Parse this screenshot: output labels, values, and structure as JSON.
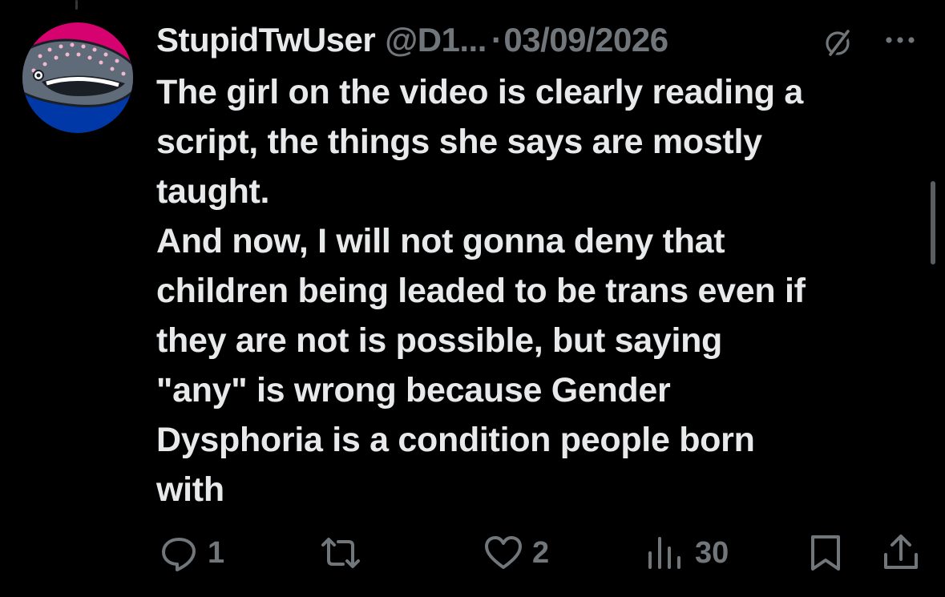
{
  "colors": {
    "background": "#000000",
    "primary_text": "#e7e9ea",
    "secondary_text": "#71767b",
    "avatar_pink": "#d6026f",
    "avatar_purple": "#734e97",
    "avatar_blue": "#0038a8"
  },
  "tweet": {
    "display_name": "StupidTwUser",
    "handle": "@D1...",
    "separator": "·",
    "date": "03/09/2026",
    "text_lines": [
      "The girl on the video is clearly reading a",
      "script, the things she says are mostly",
      "taught.",
      "And now, I will not gonna deny that",
      "children being leaded to be trans even if",
      "they are not is possible, but saying",
      "\"any\" is wrong because Gender",
      "Dysphoria is a condition people born",
      "with"
    ],
    "icons": {
      "edited": "edit-pencil-icon",
      "more": "more-options-icon"
    }
  },
  "actions": {
    "reply": {
      "icon": "reply-icon",
      "count": "1"
    },
    "retweet": {
      "icon": "retweet-icon",
      "count": ""
    },
    "like": {
      "icon": "heart-icon",
      "count": "2"
    },
    "views": {
      "icon": "views-bar-icon",
      "count": "30"
    },
    "bookmark": {
      "icon": "bookmark-icon"
    },
    "share": {
      "icon": "share-icon"
    }
  }
}
